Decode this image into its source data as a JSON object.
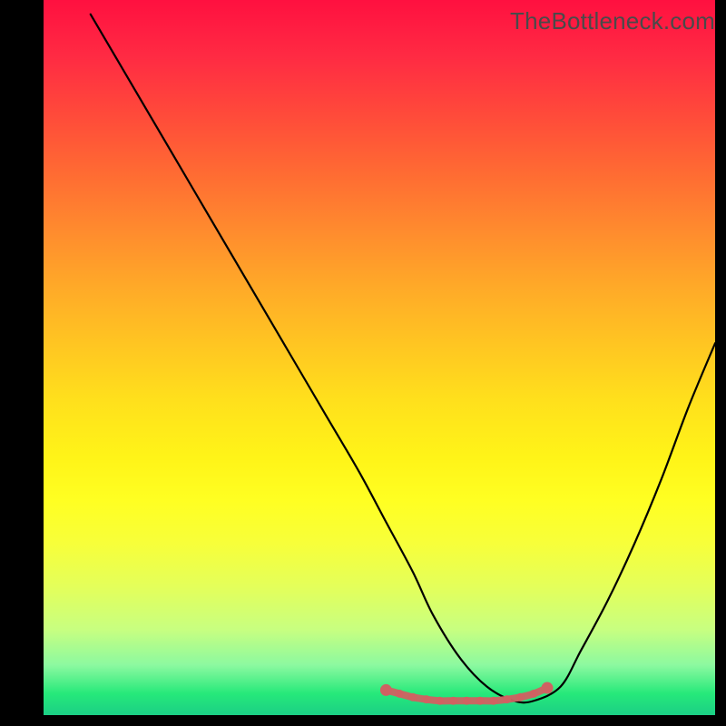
{
  "watermark": "TheBottleneck.com",
  "chart_data": {
    "type": "line",
    "title": "",
    "xlabel": "",
    "ylabel": "",
    "xlim": [
      0,
      100
    ],
    "ylim": [
      0,
      100
    ],
    "series": [
      {
        "name": "black-curve",
        "color": "#000000",
        "x": [
          7,
          12,
          17,
          22,
          27,
          32,
          37,
          42,
          47,
          51,
          55,
          58,
          62,
          66,
          70,
          73,
          77,
          80,
          84,
          88,
          92,
          96,
          100
        ],
        "values": [
          98,
          90,
          82,
          74,
          66,
          58,
          50,
          42,
          34,
          27,
          20,
          14,
          8,
          4,
          2,
          2,
          4,
          9,
          16,
          24,
          33,
          43,
          52
        ]
      },
      {
        "name": "marker-curve",
        "color": "#CF6262",
        "x": [
          51,
          53,
          55,
          57,
          59,
          61,
          63,
          65,
          67,
          69,
          71,
          73,
          75
        ],
        "values": [
          3.5,
          3.0,
          2.5,
          2.2,
          2.0,
          2.0,
          2.0,
          2.0,
          2.0,
          2.2,
          2.5,
          3.0,
          3.8
        ]
      }
    ],
    "gradient_stops": [
      {
        "pos": 0,
        "color": "#FF1040"
      },
      {
        "pos": 8,
        "color": "#FF2B43"
      },
      {
        "pos": 16,
        "color": "#FF4A3A"
      },
      {
        "pos": 24,
        "color": "#FF6A33"
      },
      {
        "pos": 32,
        "color": "#FF8A2E"
      },
      {
        "pos": 40,
        "color": "#FFA928"
      },
      {
        "pos": 48,
        "color": "#FFC522"
      },
      {
        "pos": 56,
        "color": "#FFE01C"
      },
      {
        "pos": 64,
        "color": "#FFF418"
      },
      {
        "pos": 70,
        "color": "#FFFF22"
      },
      {
        "pos": 76,
        "color": "#F7FF3A"
      },
      {
        "pos": 82,
        "color": "#E4FF5A"
      },
      {
        "pos": 88,
        "color": "#C8FF80"
      },
      {
        "pos": 93,
        "color": "#8CF9A0"
      },
      {
        "pos": 97,
        "color": "#26E97A"
      },
      {
        "pos": 100,
        "color": "#1BCF85"
      }
    ],
    "marker_color": "#CF6262",
    "curve_color": "#000000"
  }
}
